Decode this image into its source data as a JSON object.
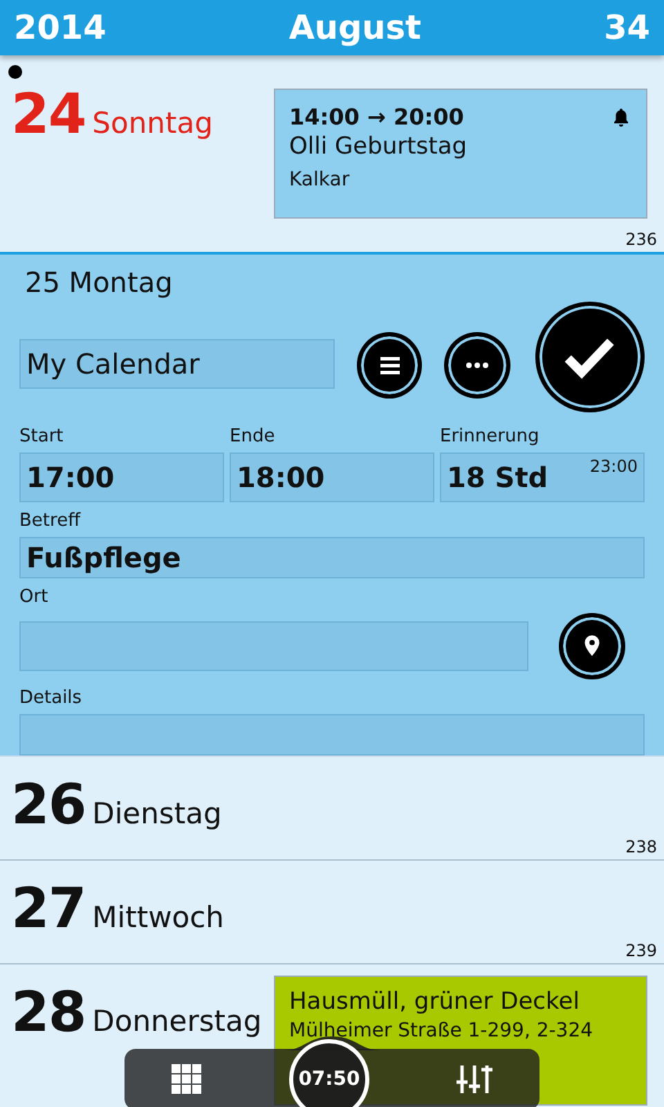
{
  "header": {
    "year": "2014",
    "month": "August",
    "week": "34"
  },
  "days": [
    {
      "kind": "plain",
      "number": "24",
      "name": "Sonntag",
      "today": true,
      "holiday": true,
      "day_of_year": "236",
      "events": [
        {
          "time": "14:00 → 20:00",
          "title": "Olli Geburtstag",
          "location": "Kalkar",
          "alarm": true,
          "color": "#8ecff0"
        }
      ]
    },
    {
      "kind": "editor",
      "title": "25 Montag",
      "calendar": "My Calendar",
      "start": {
        "label": "Start",
        "value": "17:00"
      },
      "end": {
        "label": "Ende",
        "value": "18:00"
      },
      "reminder": {
        "label": "Erinnerung",
        "value": "18 Std",
        "time": "23:00"
      },
      "subject": {
        "label": "Betreff",
        "value": "Fußpflege"
      },
      "location": {
        "label": "Ort"
      },
      "details": {
        "label": "Details"
      }
    },
    {
      "kind": "plain",
      "number": "26",
      "name": "Dienstag",
      "today": false,
      "holiday": false,
      "day_of_year": "238"
    },
    {
      "kind": "plain",
      "number": "27",
      "name": "Mittwoch",
      "today": false,
      "holiday": false,
      "day_of_year": "239"
    },
    {
      "kind": "plain",
      "number": "28",
      "name": "Donnerstag",
      "today": false,
      "holiday": false,
      "events": [
        {
          "title": "Hausmüll, grüner Deckel",
          "location": "Mülheimer Straße 1-299, 2-324",
          "alarm": false,
          "color": "#a8c800"
        }
      ]
    }
  ],
  "toolbar": {
    "time": "07:50"
  }
}
